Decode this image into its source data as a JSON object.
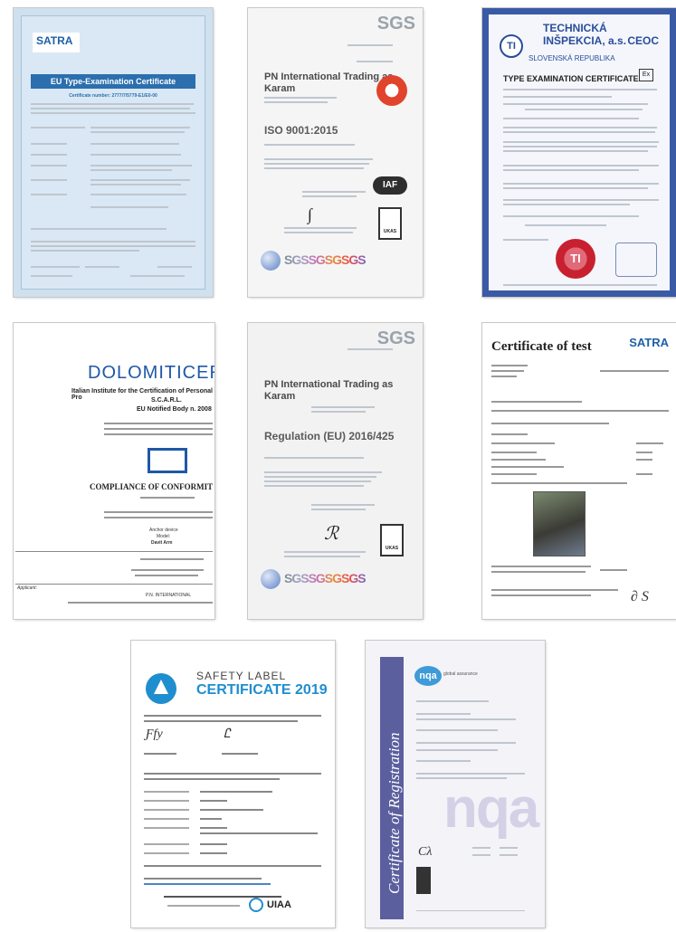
{
  "certificates": [
    {
      "id": "satra-eu",
      "logo": "SATRA",
      "title": "EU Type-Examination Certificate",
      "number_line": "Certificate number: 2777/7/5779-E1/E0-00"
    },
    {
      "id": "sgs-iso",
      "logo": "SGS",
      "company": "PN International Trading as Karam",
      "standard": "ISO 9001:2015",
      "iaf": "IAF",
      "ukas": "UKAS",
      "strip": "SGSSGSGSGS"
    },
    {
      "id": "technicka",
      "org": "TECHNICKÁ INŠPEKCIA, a.s.",
      "org_short": "TI",
      "ceoc": "CEOC",
      "country": "SLOVENSKÁ REPUBLIKA",
      "title": "TYPE EXAMINATION CERTIFICATE",
      "ex_mark": "Ex",
      "seal": "TI"
    },
    {
      "id": "dolomiticert",
      "logo": "DOLOMITICER",
      "line1": "Italian Institute for the Certification of Personal Pro",
      "line2": "S.C.A.R.L.",
      "line3": "EU Notified Body n. 2008",
      "compliance": "COMPLIANCE OF CONFORMIT",
      "device1": "Anchor device",
      "device2": "Model:",
      "device3": "Davit Arm",
      "applicant_label": "Applicant:",
      "applicant": "P.N. INTERNATIONAL"
    },
    {
      "id": "sgs-reg",
      "logo": "SGS",
      "company": "PN International Trading as Karam",
      "standard": "Regulation (EU) 2016/425",
      "ukas": "UKAS",
      "strip": "SGSSGSGSGS"
    },
    {
      "id": "satra-test",
      "title": "Certificate of test",
      "logo": "SATRA"
    },
    {
      "id": "safety-label",
      "label": "SAFETY LABEL",
      "title": "CERTIFICATE 2019",
      "uiaa": "UIAA"
    },
    {
      "id": "nqa",
      "badge": "nqa",
      "tag": "global assurance",
      "vertical": "Certificate of Registration",
      "watermark": "nqa"
    }
  ],
  "colors": {
    "satra_blue": "#2b6fae",
    "ti_blue": "#3a5aa6",
    "dolomiti_blue": "#1f58a6",
    "nqa_purple": "#5b5f9e",
    "safety_blue": "#1f8ecf"
  }
}
